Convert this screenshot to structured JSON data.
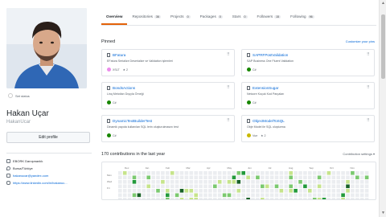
{
  "profile": {
    "status_label": "Set status",
    "name": "Hakan Uçar",
    "login": "HakanUcar",
    "edit_label": "Edit profile",
    "org": "EBORK Danışmanlık",
    "location": "Bursa/Türkiye",
    "email": "hakanucar@yandex.com",
    "website": "https://www.linkedin.com/in/hakanuc..."
  },
  "tabs": [
    {
      "label": "Overview",
      "count": ""
    },
    {
      "label": "Repositories",
      "count": "36"
    },
    {
      "label": "Projects",
      "count": "0"
    },
    {
      "label": "Packages",
      "count": "0"
    },
    {
      "label": "Stars",
      "count": "0"
    },
    {
      "label": "Followers",
      "count": "15"
    },
    {
      "label": "Following",
      "count": "96"
    }
  ],
  "pinned": {
    "title": "Pinned",
    "customize_label": "Customize your pins",
    "cards": [
      {
        "name": "BFatura",
        "desc": "EFatura Serialize Deserialize ve Validation işlemleri",
        "lang": "XSLT",
        "lang_color": "#EB8CEB",
        "stars": "2"
      },
      {
        "name": "SAPRFPostValidation",
        "desc": "SAP Business One Fluent Validation",
        "lang": "C#",
        "lang_color": "#178600",
        "stars": ""
      },
      {
        "name": "BondsActions",
        "desc": "Linq Metotları Dışıyla Örneği",
        "lang": "C#",
        "lang_color": "#178600",
        "stars": ""
      },
      {
        "name": "ExtensionSugar",
        "desc": "Netcore Koçuk Kod Parçaları",
        "lang": "C#",
        "lang_color": "#178600",
        "stars": ""
      },
      {
        "name": "DynamicTextBuilderTest",
        "desc": "Dinamik yapıda kullanılan SQL lerin oluşturulmasını test",
        "lang": "C#",
        "lang_color": "#178600",
        "stars": ""
      },
      {
        "name": "ObjectModelToSQL",
        "desc": "Obje Model ile SQL oluşturma",
        "lang": "Vue",
        "lang_color": "#c9b800",
        "stars": "2"
      }
    ]
  },
  "contributions": {
    "title": "170 contributions in the last year",
    "settings_label": "Contribution settings ▾",
    "months": [
      "Dec",
      "Jan",
      "Feb",
      "Mar",
      "Apr",
      "May",
      "Jun",
      "Jul",
      "Aug",
      "Sep",
      "Oct",
      "Nov"
    ],
    "days": [
      "Mon",
      "Wed",
      "Fri"
    ]
  },
  "colors": {
    "tab_active_border": "#e36209",
    "link": "#0366d6",
    "contrib_levels": [
      "#ebedf0",
      "#c6e48b",
      "#7bc96f",
      "#239a3b",
      "#196127"
    ]
  }
}
